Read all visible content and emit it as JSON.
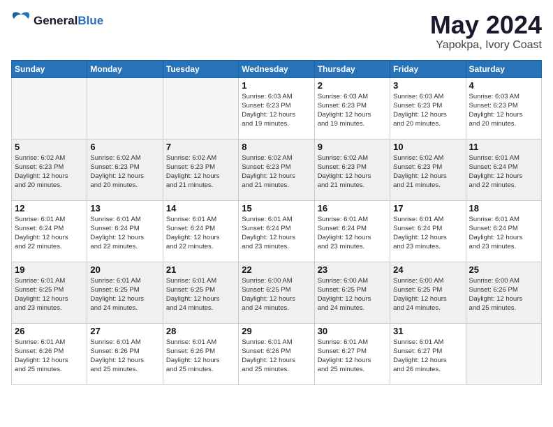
{
  "header": {
    "logo_line1": "General",
    "logo_line2": "Blue",
    "month_year": "May 2024",
    "location": "Yapokpa, Ivory Coast"
  },
  "days_of_week": [
    "Sunday",
    "Monday",
    "Tuesday",
    "Wednesday",
    "Thursday",
    "Friday",
    "Saturday"
  ],
  "weeks": [
    [
      {
        "day": "",
        "info": "",
        "empty": true
      },
      {
        "day": "",
        "info": "",
        "empty": true
      },
      {
        "day": "",
        "info": "",
        "empty": true
      },
      {
        "day": "1",
        "info": "Sunrise: 6:03 AM\nSunset: 6:23 PM\nDaylight: 12 hours\nand 19 minutes.",
        "empty": false
      },
      {
        "day": "2",
        "info": "Sunrise: 6:03 AM\nSunset: 6:23 PM\nDaylight: 12 hours\nand 19 minutes.",
        "empty": false
      },
      {
        "day": "3",
        "info": "Sunrise: 6:03 AM\nSunset: 6:23 PM\nDaylight: 12 hours\nand 20 minutes.",
        "empty": false
      },
      {
        "day": "4",
        "info": "Sunrise: 6:03 AM\nSunset: 6:23 PM\nDaylight: 12 hours\nand 20 minutes.",
        "empty": false
      }
    ],
    [
      {
        "day": "5",
        "info": "Sunrise: 6:02 AM\nSunset: 6:23 PM\nDaylight: 12 hours\nand 20 minutes.",
        "empty": false
      },
      {
        "day": "6",
        "info": "Sunrise: 6:02 AM\nSunset: 6:23 PM\nDaylight: 12 hours\nand 20 minutes.",
        "empty": false
      },
      {
        "day": "7",
        "info": "Sunrise: 6:02 AM\nSunset: 6:23 PM\nDaylight: 12 hours\nand 21 minutes.",
        "empty": false
      },
      {
        "day": "8",
        "info": "Sunrise: 6:02 AM\nSunset: 6:23 PM\nDaylight: 12 hours\nand 21 minutes.",
        "empty": false
      },
      {
        "day": "9",
        "info": "Sunrise: 6:02 AM\nSunset: 6:23 PM\nDaylight: 12 hours\nand 21 minutes.",
        "empty": false
      },
      {
        "day": "10",
        "info": "Sunrise: 6:02 AM\nSunset: 6:23 PM\nDaylight: 12 hours\nand 21 minutes.",
        "empty": false
      },
      {
        "day": "11",
        "info": "Sunrise: 6:01 AM\nSunset: 6:24 PM\nDaylight: 12 hours\nand 22 minutes.",
        "empty": false
      }
    ],
    [
      {
        "day": "12",
        "info": "Sunrise: 6:01 AM\nSunset: 6:24 PM\nDaylight: 12 hours\nand 22 minutes.",
        "empty": false
      },
      {
        "day": "13",
        "info": "Sunrise: 6:01 AM\nSunset: 6:24 PM\nDaylight: 12 hours\nand 22 minutes.",
        "empty": false
      },
      {
        "day": "14",
        "info": "Sunrise: 6:01 AM\nSunset: 6:24 PM\nDaylight: 12 hours\nand 22 minutes.",
        "empty": false
      },
      {
        "day": "15",
        "info": "Sunrise: 6:01 AM\nSunset: 6:24 PM\nDaylight: 12 hours\nand 23 minutes.",
        "empty": false
      },
      {
        "day": "16",
        "info": "Sunrise: 6:01 AM\nSunset: 6:24 PM\nDaylight: 12 hours\nand 23 minutes.",
        "empty": false
      },
      {
        "day": "17",
        "info": "Sunrise: 6:01 AM\nSunset: 6:24 PM\nDaylight: 12 hours\nand 23 minutes.",
        "empty": false
      },
      {
        "day": "18",
        "info": "Sunrise: 6:01 AM\nSunset: 6:24 PM\nDaylight: 12 hours\nand 23 minutes.",
        "empty": false
      }
    ],
    [
      {
        "day": "19",
        "info": "Sunrise: 6:01 AM\nSunset: 6:25 PM\nDaylight: 12 hours\nand 23 minutes.",
        "empty": false
      },
      {
        "day": "20",
        "info": "Sunrise: 6:01 AM\nSunset: 6:25 PM\nDaylight: 12 hours\nand 24 minutes.",
        "empty": false
      },
      {
        "day": "21",
        "info": "Sunrise: 6:01 AM\nSunset: 6:25 PM\nDaylight: 12 hours\nand 24 minutes.",
        "empty": false
      },
      {
        "day": "22",
        "info": "Sunrise: 6:00 AM\nSunset: 6:25 PM\nDaylight: 12 hours\nand 24 minutes.",
        "empty": false
      },
      {
        "day": "23",
        "info": "Sunrise: 6:00 AM\nSunset: 6:25 PM\nDaylight: 12 hours\nand 24 minutes.",
        "empty": false
      },
      {
        "day": "24",
        "info": "Sunrise: 6:00 AM\nSunset: 6:25 PM\nDaylight: 12 hours\nand 24 minutes.",
        "empty": false
      },
      {
        "day": "25",
        "info": "Sunrise: 6:00 AM\nSunset: 6:26 PM\nDaylight: 12 hours\nand 25 minutes.",
        "empty": false
      }
    ],
    [
      {
        "day": "26",
        "info": "Sunrise: 6:01 AM\nSunset: 6:26 PM\nDaylight: 12 hours\nand 25 minutes.",
        "empty": false
      },
      {
        "day": "27",
        "info": "Sunrise: 6:01 AM\nSunset: 6:26 PM\nDaylight: 12 hours\nand 25 minutes.",
        "empty": false
      },
      {
        "day": "28",
        "info": "Sunrise: 6:01 AM\nSunset: 6:26 PM\nDaylight: 12 hours\nand 25 minutes.",
        "empty": false
      },
      {
        "day": "29",
        "info": "Sunrise: 6:01 AM\nSunset: 6:26 PM\nDaylight: 12 hours\nand 25 minutes.",
        "empty": false
      },
      {
        "day": "30",
        "info": "Sunrise: 6:01 AM\nSunset: 6:27 PM\nDaylight: 12 hours\nand 25 minutes.",
        "empty": false
      },
      {
        "day": "31",
        "info": "Sunrise: 6:01 AM\nSunset: 6:27 PM\nDaylight: 12 hours\nand 26 minutes.",
        "empty": false
      },
      {
        "day": "",
        "info": "",
        "empty": true
      }
    ]
  ]
}
